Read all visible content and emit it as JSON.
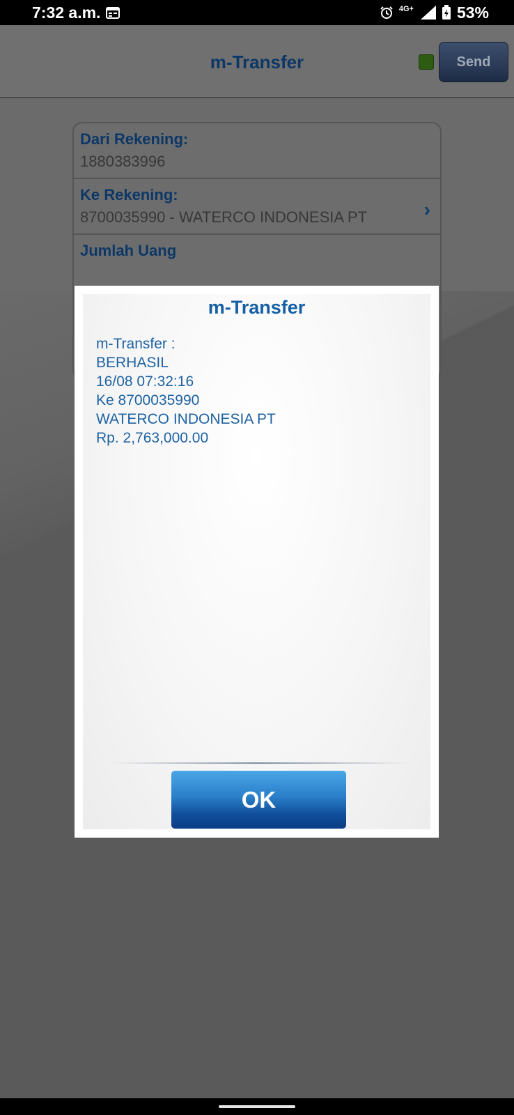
{
  "status_bar": {
    "time": "7:32 a.m.",
    "network": "4G+",
    "battery": "53%"
  },
  "header": {
    "title": "m-Transfer",
    "status_indicator_color": "#2e5b12",
    "send_label": "Send"
  },
  "form": {
    "from_label": "Dari Rekening:",
    "from_value": "1880383996",
    "to_label": "Ke Rekening:",
    "to_value": "8700035990 - WATERCO INDONESIA PT",
    "amount_label": "Jumlah Uang"
  },
  "dialog": {
    "title": "m-Transfer",
    "lines": [
      "m-Transfer :",
      "BERHASIL",
      "16/08 07:32:16",
      "Ke 8700035990",
      "WATERCO INDONESIA PT",
      "Rp. 2,763,000.00"
    ],
    "ok_label": "OK"
  },
  "icons": {
    "calendar": "calendar-icon",
    "alarm": "alarm-icon",
    "signal": "signal-icon",
    "battery": "battery-icon",
    "chevron": "chevron-right-icon"
  }
}
